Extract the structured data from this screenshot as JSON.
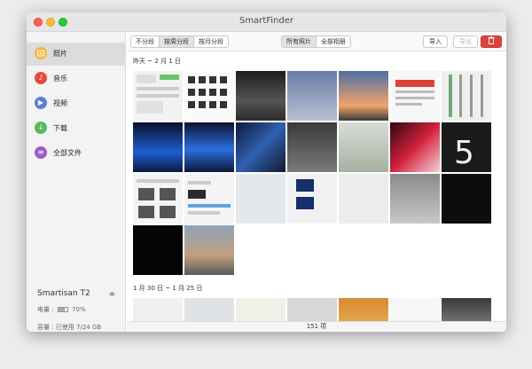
{
  "window": {
    "title": "SmartFinder"
  },
  "sidebar": {
    "items": [
      {
        "label": "照片",
        "icon": "photo-icon",
        "color": "#f5b83b"
      },
      {
        "label": "音乐",
        "icon": "music-icon",
        "color": "#e8493f"
      },
      {
        "label": "视频",
        "icon": "video-icon",
        "color": "#5b7fd6"
      },
      {
        "label": "下载",
        "icon": "download-icon",
        "color": "#5cb85c"
      },
      {
        "label": "全部文件",
        "icon": "files-icon",
        "color": "#9a5fc7"
      }
    ],
    "active": 0,
    "device": {
      "name": "Smartisan T2",
      "battery_label": "电量 :",
      "battery_value": "70%",
      "battery_level": 0.7,
      "capacity_label": "容量 : 已使用 7/24 GB"
    }
  },
  "toolbar": {
    "group_segments": [
      "不分段",
      "按周分段",
      "按月分段"
    ],
    "group_active": 1,
    "filter_segments": [
      "所有照片",
      "全部相册"
    ],
    "filter_active": 0,
    "import_label": "导入",
    "export_label": "导出",
    "delete_label": "🗑"
  },
  "sections": [
    {
      "title": "昨天 ~ 2 月 1 日"
    },
    {
      "title": "1 月 30 日 ~ 1 月 25 日"
    }
  ],
  "status": {
    "text": "151 项"
  }
}
